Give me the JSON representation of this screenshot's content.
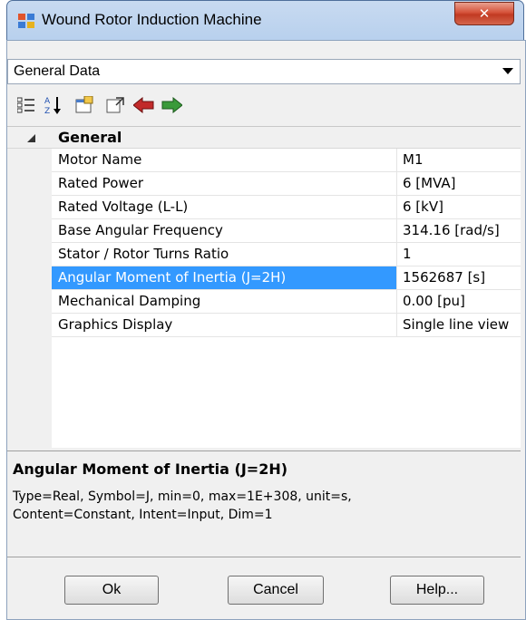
{
  "window": {
    "title": "Wound Rotor Induction Machine",
    "close_glyph": "✕"
  },
  "combo": {
    "value": "General Data",
    "arrow": "▼"
  },
  "toolbar": {
    "items": [
      {
        "name": "categorized-view-icon"
      },
      {
        "name": "sort-alphabetical-icon"
      },
      {
        "name": "property-pages-icon"
      },
      {
        "name": "export-icon"
      },
      {
        "name": "arrow-left-icon"
      },
      {
        "name": "arrow-right-icon"
      }
    ]
  },
  "grid": {
    "category": "General",
    "rows": [
      {
        "name": "Motor Name",
        "value": "M1"
      },
      {
        "name": "Rated Power",
        "value": "6 [MVA]"
      },
      {
        "name": "Rated Voltage (L-L)",
        "value": "6 [kV]"
      },
      {
        "name": "Base Angular Frequency",
        "value": "314.16 [rad/s]"
      },
      {
        "name": "Stator / Rotor Turns Ratio",
        "value": "1"
      },
      {
        "name": "Angular Moment of Inertia (J=2H)",
        "value": "1562687 [s]"
      },
      {
        "name": "Mechanical Damping",
        "value": "0.00 [pu]"
      },
      {
        "name": "Graphics Display",
        "value": "Single line view"
      }
    ],
    "selected_index": 5
  },
  "description": {
    "title": "Angular Moment of Inertia (J=2H)",
    "line1": "Type=Real, Symbol=J, min=0, max=1E+308, unit=s,",
    "line2": "Content=Constant, Intent=Input, Dim=1"
  },
  "buttons": {
    "ok": "Ok",
    "cancel": "Cancel",
    "help": "Help..."
  },
  "colors": {
    "selection": "#3399ff",
    "close": "#c13a22"
  }
}
